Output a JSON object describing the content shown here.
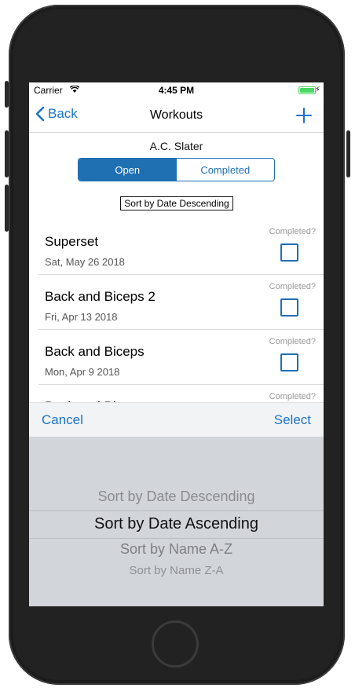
{
  "status": {
    "carrier": "Carrier",
    "time": "4:45 PM"
  },
  "nav": {
    "back_label": "Back",
    "title": "Workouts"
  },
  "owner": "A.C. Slater",
  "segments": [
    {
      "label": "Open"
    },
    {
      "label": "Completed"
    }
  ],
  "sort_label": "Sort by Date Descending",
  "workouts": [
    {
      "title": "Superset",
      "date": "Sat, May 26 2018",
      "completed_label": "Completed?"
    },
    {
      "title": "Back and Biceps 2",
      "date": "Fri, Apr 13 2018",
      "completed_label": "Completed?"
    },
    {
      "title": "Back and Biceps",
      "date": "Mon, Apr 9 2018",
      "completed_label": "Completed?"
    },
    {
      "title": "Back and Biceps",
      "date": "",
      "completed_label": "Completed?"
    }
  ],
  "picker": {
    "cancel_label": "Cancel",
    "select_label": "Select",
    "options": [
      "Sort by Date Descending",
      "Sort by Date Ascending",
      "Sort by Name A-Z",
      "Sort by Name Z-A"
    ],
    "selected_index": 1
  },
  "colors": {
    "accent": "#1f6fb3",
    "link": "#1a73c9",
    "battery": "#4cd964"
  }
}
